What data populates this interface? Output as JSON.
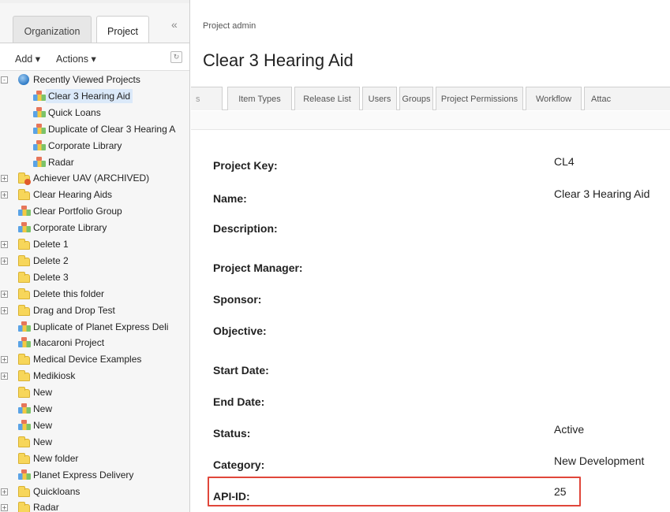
{
  "left": {
    "tabs": {
      "organization": "Organization",
      "project": "Project"
    },
    "collapse_icon": "«",
    "toolbar": {
      "add": "Add",
      "actions": "Actions"
    },
    "tree": [
      {
        "label": "Recently Viewed Projects",
        "icon": "globe-icon",
        "expander": "-",
        "selected": false
      },
      {
        "label": "Clear 3 Hearing Aid",
        "icon": "project-icon",
        "expander": "",
        "selected": true
      },
      {
        "label": "Quick Loans",
        "icon": "project-icon",
        "expander": "",
        "selected": false
      },
      {
        "label": "Duplicate of Clear 3 Hearing A",
        "icon": "project-icon",
        "expander": "",
        "selected": false
      },
      {
        "label": "Corporate Library",
        "icon": "project-icon",
        "expander": "",
        "selected": false
      },
      {
        "label": "Radar",
        "icon": "project-icon",
        "expander": "",
        "selected": false
      },
      {
        "label": "Achiever UAV (ARCHIVED)",
        "icon": "archived-folder-icon",
        "expander": "+",
        "selected": false
      },
      {
        "label": "Clear Hearing Aids",
        "icon": "folder-icon",
        "expander": "+",
        "selected": false
      },
      {
        "label": "Clear Portfolio Group",
        "icon": "project-icon",
        "expander": "",
        "selected": false
      },
      {
        "label": "Corporate Library",
        "icon": "project-icon",
        "expander": "",
        "selected": false
      },
      {
        "label": "Delete 1",
        "icon": "folder-icon",
        "expander": "+",
        "selected": false
      },
      {
        "label": "Delete 2",
        "icon": "folder-icon",
        "expander": "+",
        "selected": false
      },
      {
        "label": "Delete 3",
        "icon": "folder-icon",
        "expander": "",
        "selected": false
      },
      {
        "label": "Delete this folder",
        "icon": "folder-icon",
        "expander": "+",
        "selected": false
      },
      {
        "label": "Drag and Drop Test",
        "icon": "folder-icon",
        "expander": "+",
        "selected": false
      },
      {
        "label": "Duplicate of Planet Express Deli",
        "icon": "project-icon",
        "expander": "",
        "selected": false
      },
      {
        "label": "Macaroni Project",
        "icon": "project-icon",
        "expander": "",
        "selected": false
      },
      {
        "label": "Medical Device Examples",
        "icon": "folder-icon",
        "expander": "+",
        "selected": false
      },
      {
        "label": "Medikiosk",
        "icon": "folder-icon",
        "expander": "+",
        "selected": false
      },
      {
        "label": "New",
        "icon": "folder-icon",
        "expander": "",
        "selected": false
      },
      {
        "label": "New",
        "icon": "project-icon",
        "expander": "",
        "selected": false
      },
      {
        "label": "New",
        "icon": "project-icon",
        "expander": "",
        "selected": false
      },
      {
        "label": "New",
        "icon": "folder-icon",
        "expander": "",
        "selected": false
      },
      {
        "label": "New folder",
        "icon": "folder-icon",
        "expander": "",
        "selected": false
      },
      {
        "label": "Planet Express Delivery",
        "icon": "project-icon",
        "expander": "",
        "selected": false
      },
      {
        "label": "Quickloans",
        "icon": "folder-icon",
        "expander": "+",
        "selected": false
      },
      {
        "label": "Radar",
        "icon": "folder-icon",
        "expander": "+",
        "selected": false
      }
    ]
  },
  "main": {
    "breadcrumb": "Project admin",
    "title": "Clear 3 Hearing Aid",
    "tabs": [
      {
        "label": "s"
      },
      {
        "label": "Item Types"
      },
      {
        "label": "Release List"
      },
      {
        "label": "Users"
      },
      {
        "label": "Groups"
      },
      {
        "label": "Project Permissions"
      },
      {
        "label": "Workflow"
      },
      {
        "label": "Attac"
      }
    ],
    "fields": [
      {
        "label": "Project Key:",
        "value": "CL4"
      },
      {
        "label": "Name:",
        "value": "Clear 3 Hearing Aid"
      },
      {
        "label": "Description:",
        "value": ""
      },
      {
        "label": "Project Manager:",
        "value": ""
      },
      {
        "label": "Sponsor:",
        "value": ""
      },
      {
        "label": "Objective:",
        "value": ""
      },
      {
        "label": "Start Date:",
        "value": ""
      },
      {
        "label": "End Date:",
        "value": ""
      },
      {
        "label": "Status:",
        "value": "Active"
      },
      {
        "label": "Category:",
        "value": "New Development"
      },
      {
        "label": "API-ID:",
        "value": "25"
      }
    ]
  },
  "colors": {
    "highlight_border": "#e0463a",
    "selected_bg": "#dbe9f9"
  }
}
